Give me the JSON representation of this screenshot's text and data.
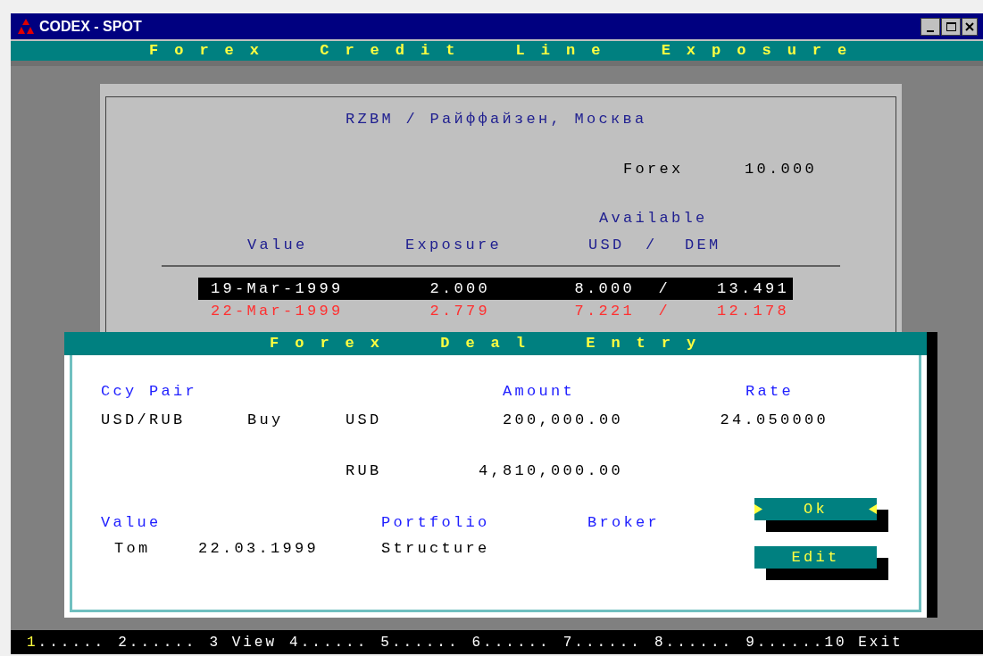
{
  "window": {
    "title": "CODEX - SPOT"
  },
  "screen_title": "Forex Credit Line Exposure",
  "exposure": {
    "counterparty": "RZBM / Райффайзен, Москва",
    "limit_label": "Forex",
    "limit_value": "10.000",
    "available_label": "Available",
    "columns": [
      "Value",
      "Exposure",
      "USD",
      "/",
      "DEM"
    ],
    "rows": [
      {
        "value": "19-Mar-1999",
        "exposure": "2.000",
        "usd": "8.000",
        "sep": "/",
        "dem": "13.491",
        "selected": true,
        "alert": false
      },
      {
        "value": "22-Mar-1999",
        "exposure": "2.779",
        "usd": "7.221",
        "sep": "/",
        "dem": "12.178",
        "selected": false,
        "alert": true
      }
    ]
  },
  "dialog": {
    "title": "Forex Deal Entry",
    "ccy_pair_label": "Ccy Pair",
    "amount_label": "Amount",
    "rate_label": "Rate",
    "ccy_pair": "USD/RUB",
    "direction": "Buy",
    "ccy1": "USD",
    "amount1": "200,000.00",
    "rate": "24.050000",
    "ccy2": "RUB",
    "amount2": "4,810,000.00",
    "value_label": "Value",
    "portfolio_label": "Portfolio",
    "broker_label": "Broker",
    "value_tenor": "Tom",
    "value_date": "22.03.1999",
    "portfolio": "Structure",
    "buttons": [
      {
        "label": "Ok",
        "focused": true
      },
      {
        "label": "Edit",
        "focused": false
      }
    ]
  },
  "function_keys": [
    {
      "key": "1",
      "label": "......",
      "selected": true
    },
    {
      "key": "2",
      "label": "......",
      "selected": false
    },
    {
      "key": "3",
      "label": " View",
      "selected": false
    },
    {
      "key": "4",
      "label": "......",
      "selected": false
    },
    {
      "key": "5",
      "label": "......",
      "selected": false
    },
    {
      "key": "6",
      "label": "......",
      "selected": false
    },
    {
      "key": "7",
      "label": "......",
      "selected": false
    },
    {
      "key": "8",
      "label": "......",
      "selected": false
    },
    {
      "key": "9",
      "label": "......",
      "selected": false
    },
    {
      "key": "10",
      "label": " Exit",
      "selected": false
    }
  ]
}
